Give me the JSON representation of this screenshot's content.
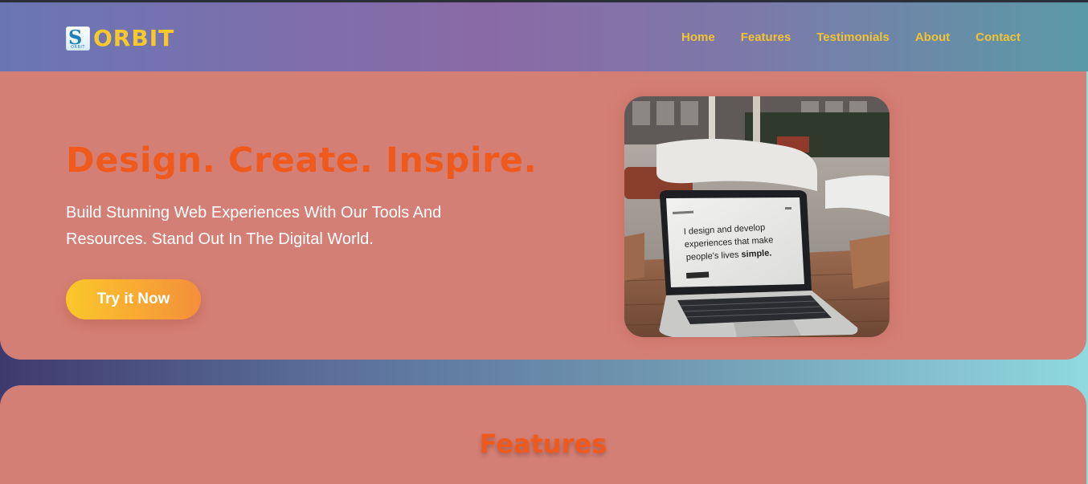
{
  "brand": {
    "name": "ORBIT",
    "logo_icon": "orbit-logo-icon",
    "logo_badge_text": "ORBIT",
    "logo_mark": "S"
  },
  "nav": {
    "items": [
      "Home",
      "Features",
      "Testimonials",
      "About",
      "Contact"
    ]
  },
  "hero": {
    "title": "Design. Create. Inspire.",
    "subtitle": "Build Stunning Web Experiences With Our Tools And Resources. Stand Out In The Digital World.",
    "cta_label": "Try it Now",
    "image": {
      "laptop_text_line1": "I design and develop",
      "laptop_text_line2": "experiences that make",
      "laptop_text_line3a": "people's lives ",
      "laptop_text_line3b": "simple."
    }
  },
  "features": {
    "title": "Features"
  },
  "colors": {
    "accent_orange": "#ef5a1c",
    "nav_yellow": "#f2c334",
    "hero_bg": "#d47f75",
    "cta_start": "#fcc72b",
    "cta_end": "#f48f3a"
  }
}
